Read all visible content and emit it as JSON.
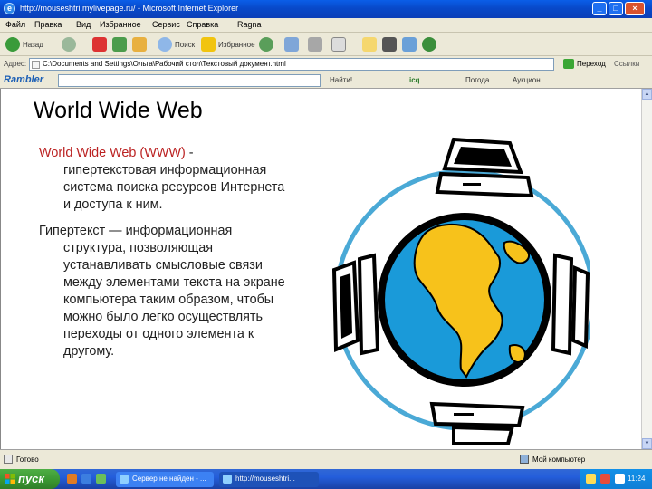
{
  "window": {
    "title": "http://mouseshtri.mylivepage.ru/ - Microsoft Internet Explorer",
    "controls": [
      "_",
      "□",
      "×"
    ]
  },
  "menu": [
    "Файл",
    "Правка",
    "Вид",
    "Избранное",
    "Сервис",
    "Справка",
    "Ragna"
  ],
  "toolbar": {
    "back": "Назад",
    "search": "Поиск",
    "favorites": "Избранное"
  },
  "address": {
    "label": "Адрес:",
    "value": "C:\\Documents and Settings\\Ольга\\Рабочий стол\\Текстовый документ.html",
    "go": "Переход",
    "links": "Ссылки"
  },
  "rambler": {
    "logo": "Rambler",
    "find": "Найти!",
    "icq": "icq",
    "weather": "Погода",
    "auction": "Аукцион"
  },
  "page": {
    "title": "World Wide Web",
    "p1_term": "World Wide Web (WWW)",
    "p1_dash": " -",
    "p1_lines": [
      "гипертекстовая информационная",
      "система поиска ресурсов Интернета",
      "и доступа к ним."
    ],
    "p2_first": "Гипертекст — информационная",
    "p2_lines": [
      "структура, позволяющая",
      "устанавливать смысловые связи",
      "между элементами текста на экране",
      "компьютера таким образом, чтобы",
      "можно было легко осуществлять",
      "переходы от одного элемента к",
      "другому."
    ]
  },
  "status": {
    "left": "Готово",
    "zone": "Мой компьютер"
  },
  "taskbar": {
    "start": "пуск",
    "tasks": [
      "Сервер не найден - ...",
      "http://mouseshtri..."
    ],
    "clock": "11:24"
  },
  "colors": {
    "ocean": "#1a9ad9",
    "land": "#f7c21b",
    "globe_outline": "#000000",
    "ring": "#4aa9d6",
    "term_red": "#b22222"
  }
}
